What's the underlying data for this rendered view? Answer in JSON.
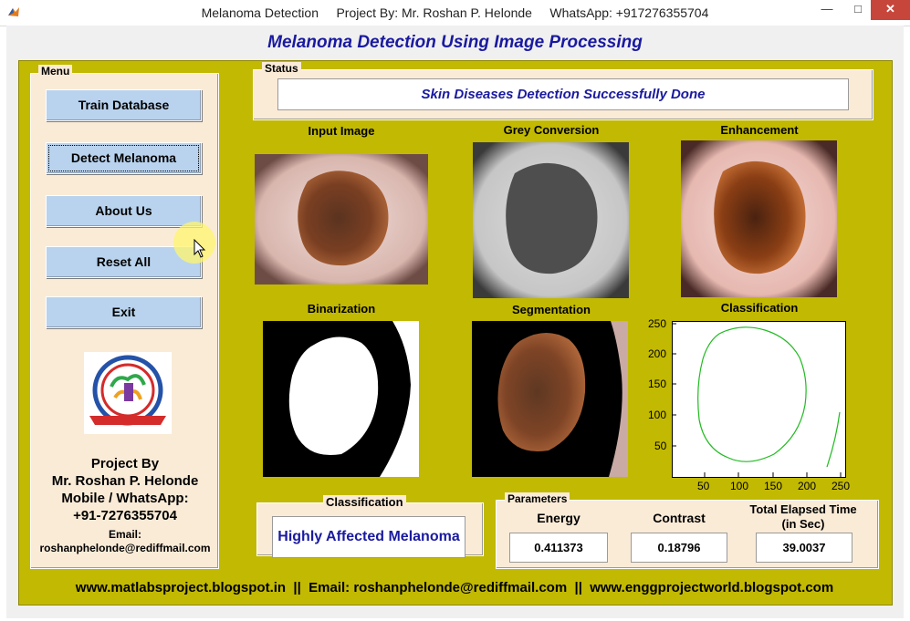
{
  "window": {
    "title": "Melanoma Detection     Project By: Mr. Roshan P. Helonde     WhatsApp: +917276355704",
    "minimize": "—",
    "maximize": "□",
    "close": "✕"
  },
  "heading": "Melanoma Detection Using Image Processing",
  "menu": {
    "title": "Menu",
    "buttons": [
      "Train Database",
      "Detect Melanoma",
      "About Us",
      "Reset All",
      "Exit"
    ]
  },
  "credits": {
    "line1": "Project By",
    "line2": "Mr. Roshan P. Helonde",
    "line3": "Mobile / WhatsApp:",
    "line4": "+91-7276355704",
    "email_label": "Email:",
    "email": "roshanphelonde@rediffmail.com"
  },
  "status": {
    "title": "Status",
    "message": "Skin Diseases Detection Successfully Done"
  },
  "images": {
    "input": "Input Image",
    "grey": "Grey Conversion",
    "enhancement": "Enhancement",
    "binarization": "Binarization",
    "segmentation": "Segmentation",
    "classification": "Classification"
  },
  "plot": {
    "yticks": [
      "250",
      "200",
      "150",
      "100",
      "50"
    ],
    "xticks": [
      "50",
      "100",
      "150",
      "200",
      "250"
    ],
    "line_color": "#22bb22"
  },
  "classification": {
    "title": "Classification",
    "result": "Highly Affected Melanoma"
  },
  "parameters": {
    "title": "Parameters",
    "energy_label": "Energy",
    "energy_value": "0.411373",
    "contrast_label": "Contrast",
    "contrast_value": "0.18796",
    "time_label_1": "Total Elapsed Time",
    "time_label_2": "(in Sec)",
    "time_value": "39.0037"
  },
  "footer": "www.matlabsproject.blogspot.in  ||  Email: roshanphelonde@rediffmail.com  ||  www.enggprojectworld.blogspot.com",
  "colors": {
    "board": "#c2b902",
    "panel": "#faebd7",
    "button": "#b9d3ee",
    "accent_text": "#1a1aa0"
  }
}
